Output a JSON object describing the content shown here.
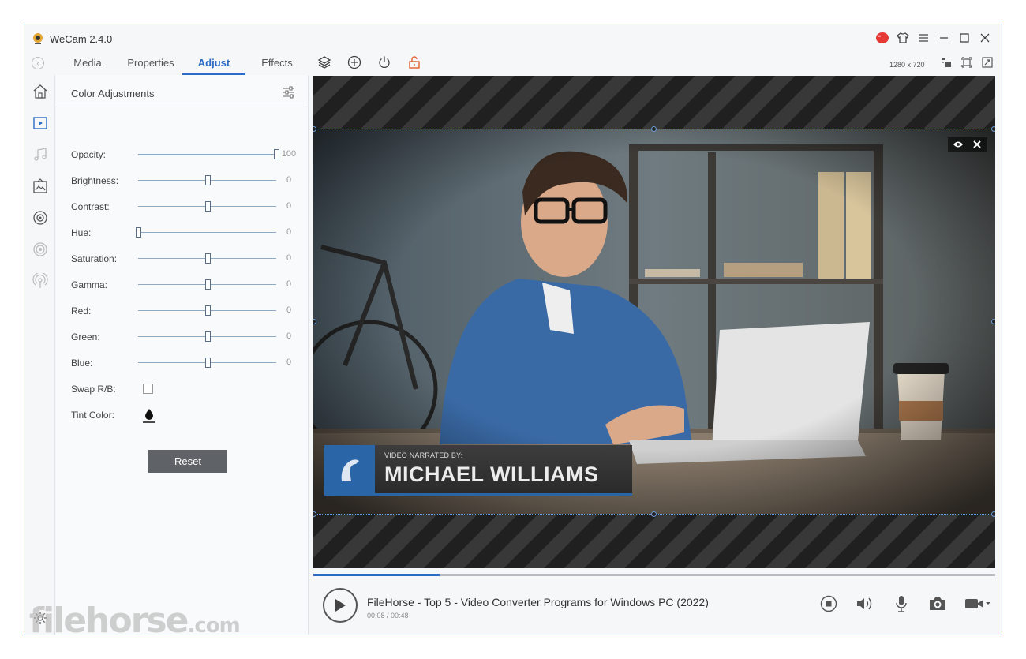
{
  "app": {
    "title": "WeCam 2.4.0"
  },
  "tabs": [
    {
      "label": "Media",
      "active": false
    },
    {
      "label": "Properties",
      "active": false
    },
    {
      "label": "Adjust",
      "active": true
    },
    {
      "label": "Effects",
      "active": false
    }
  ],
  "toolbar": {
    "resolution": "1280 x 720"
  },
  "panel": {
    "title": "Color Adjustments",
    "sliders": [
      {
        "label": "Opacity:",
        "value": "100",
        "position": 1.0
      },
      {
        "label": "Brightness:",
        "value": "0",
        "position": 0.5
      },
      {
        "label": "Contrast:",
        "value": "0",
        "position": 0.5
      },
      {
        "label": "Hue:",
        "value": "0",
        "position": 0.0
      },
      {
        "label": "Saturation:",
        "value": "0",
        "position": 0.5
      },
      {
        "label": "Gamma:",
        "value": "0",
        "position": 0.5
      },
      {
        "label": "Red:",
        "value": "0",
        "position": 0.5
      },
      {
        "label": "Green:",
        "value": "0",
        "position": 0.5
      },
      {
        "label": "Blue:",
        "value": "0",
        "position": 0.5
      }
    ],
    "swap_label": "Swap R/B:",
    "swap_checked": false,
    "tint_label": "Tint Color:",
    "reset_label": "Reset"
  },
  "preview": {
    "lower_third_small": "VIDEO NARRATED BY:",
    "lower_third_name": "MICHAEL WILLIAMS"
  },
  "player": {
    "title": "FileHorse - Top 5 - Video Converter Programs for Windows PC (2022)",
    "time": "00:08 / 00:48",
    "progress": 0.185
  },
  "watermark": {
    "text": "filehorse",
    "suffix": ".com"
  },
  "colors": {
    "accent": "#2b6cc4",
    "reset_bg": "#5f6368",
    "window_border": "#5b8fd0"
  }
}
